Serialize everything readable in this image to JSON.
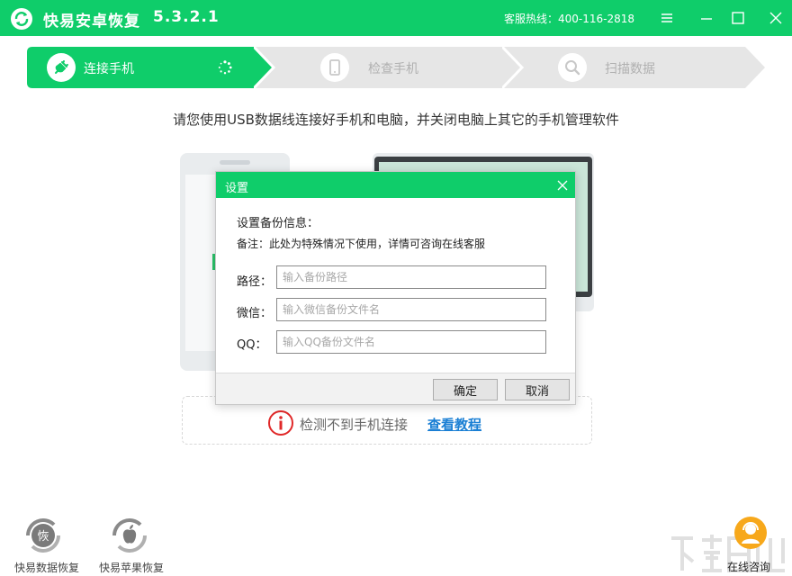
{
  "app": {
    "title": "快易安卓恢复",
    "version": "5.3.2.1",
    "hotline": "客服热线：400-116-2818"
  },
  "steps": [
    {
      "label": "连接手机",
      "active": true,
      "icon": "plug-icon"
    },
    {
      "label": "检查手机",
      "active": false,
      "icon": "phone-icon"
    },
    {
      "label": "扫描数据",
      "active": false,
      "icon": "search-icon"
    }
  ],
  "instruction": "请您使用USB数据线连接好手机和电脑，并关闭电脑上其它的手机管理软件",
  "detect": {
    "message": "检测不到手机连接",
    "link": "查看教程"
  },
  "dialog": {
    "title": "设置",
    "heading": "设置备份信息：",
    "note": "备注：此处为特殊情况下使用，详情可咨询在线客服",
    "fields": [
      {
        "label": "路径：",
        "value": "",
        "placeholder": "输入备份路径"
      },
      {
        "label": "微信：",
        "value": "",
        "placeholder": "输入微信备份文件名"
      },
      {
        "label": "QQ：",
        "value": "",
        "placeholder": "输入QQ备份文件名"
      }
    ],
    "confirm": "确定",
    "cancel": "取消"
  },
  "bottom_tools": [
    {
      "label": "快易数据恢复",
      "icon_text": "恢"
    },
    {
      "label": "快易苹果恢复",
      "icon": "apple-icon"
    }
  ],
  "consult": {
    "label": "在线咨询"
  },
  "colors": {
    "brand": "#0fcd6a",
    "inactive_step": "#e6e6e6",
    "link": "#1a7fd4",
    "alert": "#e02828",
    "consult": "#f7a81b"
  }
}
